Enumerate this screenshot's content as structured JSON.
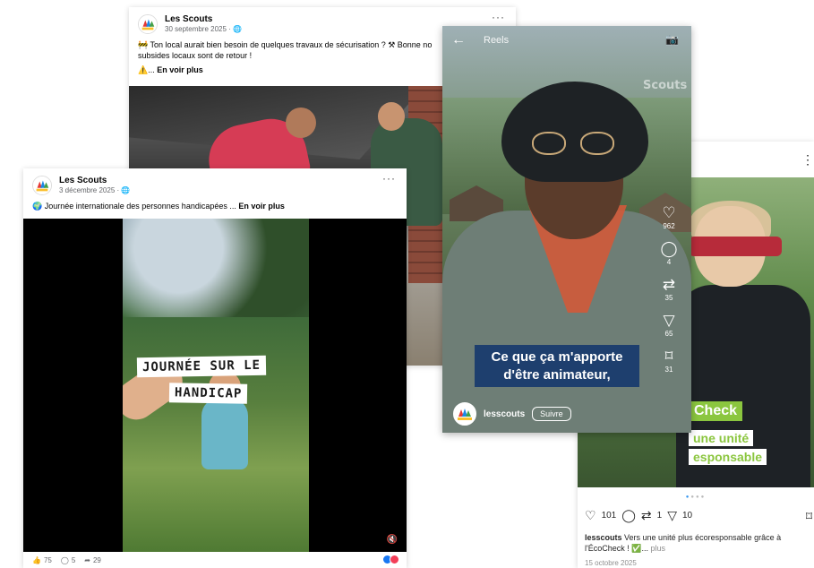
{
  "post1": {
    "page_name": "Les Scouts",
    "date": "30 septembre 2025 · ",
    "more": "···",
    "text": "🚧 Ton local aurait bien besoin de quelques travaux de sécurisation ? ⚒ Bonne no... subsides locaux sont de retour !",
    "text_line1": "🚧 Ton local aurait bien besoin de quelques travaux de sécurisation ? ⚒ Bonne no",
    "text_line2": "subsides locaux sont de retour !",
    "see_more_prefix": "⚠️... ",
    "see_more": "En voir plus"
  },
  "post2": {
    "page_name": "Les Scouts",
    "date": "3 décembre 2025 · ",
    "more": "···",
    "text": "🌍 Journée internationale des personnes handicapées ...",
    "see_more": "En voir plus",
    "video_caption_1": "JOURNÉE SUR LE",
    "video_caption_2": "HANDICAP",
    "volume_icon": "volume-muted-icon",
    "likes": "75",
    "comments": "5",
    "shares": "29"
  },
  "reel": {
    "back_icon": "arrow-left-icon",
    "title": "Reels",
    "camera_icon": "camera-icon",
    "watermark": "Scouts",
    "likes": "962",
    "comments": "4",
    "reposts": "35",
    "shares": "65",
    "saves": "31",
    "subtitle": "Ce que ça m'apporte d'être animateur,",
    "username": "lesscouts",
    "follow_label": "Suivre"
  },
  "ig_post": {
    "more": "⋮",
    "overlay_title": "Check",
    "overlay_line1": "une unité",
    "overlay_line2": "esponsable",
    "likes": "101",
    "reposts": "1",
    "shares": "10",
    "username": "lesscouts",
    "caption": " Vers une unité plus écoresponsable grâce à l'ÉcoCheck ! ✅...",
    "caption_more": " plus",
    "date": "15 octobre 2025"
  },
  "colors": {
    "facebook_blue": "#1877f2",
    "reel_subtitle_bg": "#1e3f6e",
    "eco_green": "#8bc63f",
    "scarf_red": "#b72b3a"
  }
}
